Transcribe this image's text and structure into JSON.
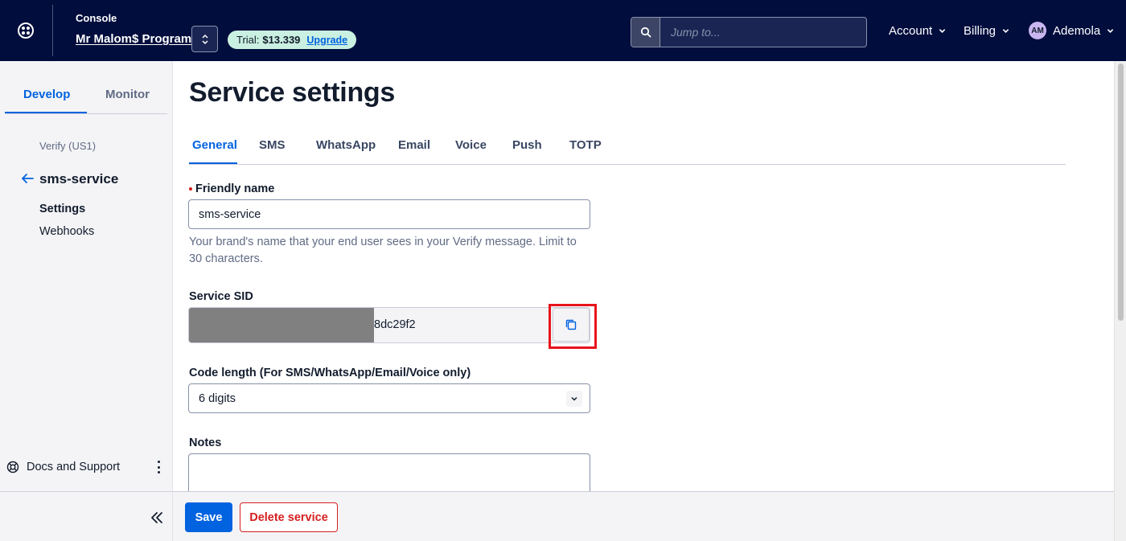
{
  "header": {
    "console_label": "Console",
    "account_name": "Mr Malom$ Program",
    "trial_label": "Trial:",
    "trial_amount": "$13.339",
    "upgrade_label": "Upgrade",
    "search_placeholder": "Jump to...",
    "account_menu": "Account",
    "billing_menu": "Billing",
    "user_initials": "AM",
    "user_name": "Ademola"
  },
  "sidebar": {
    "tabs": [
      "Develop",
      "Monitor"
    ],
    "active_tab": "Develop",
    "breadcrumb": "Verify (US1)",
    "service_name": "sms-service",
    "links": [
      "Settings",
      "Webhooks"
    ],
    "active_link": "Settings",
    "docs_label": "Docs and Support"
  },
  "main": {
    "title": "Service settings",
    "tabs": [
      "General",
      "SMS",
      "WhatsApp",
      "Email",
      "Voice",
      "Push",
      "TOTP"
    ],
    "active_tab": "General",
    "friendly_name": {
      "label": "Friendly name",
      "value": "sms-service",
      "help": "Your brand's name that your end user sees in your Verify message. Limit to 30 characters."
    },
    "service_sid": {
      "label": "Service SID",
      "value_visible": "8dc29f2"
    },
    "code_length": {
      "label": "Code length (For SMS/WhatsApp/Email/Voice only)",
      "value": "6 digits"
    },
    "notes": {
      "label": "Notes",
      "value": ""
    }
  },
  "footer": {
    "save_label": "Save",
    "delete_label": "Delete service"
  },
  "colors": {
    "topbar": "#000d3d",
    "primary": "#0263e0",
    "destructive": "#d61f1f",
    "highlight": "#e8141b",
    "trial_pill": "#c9f0e0"
  }
}
